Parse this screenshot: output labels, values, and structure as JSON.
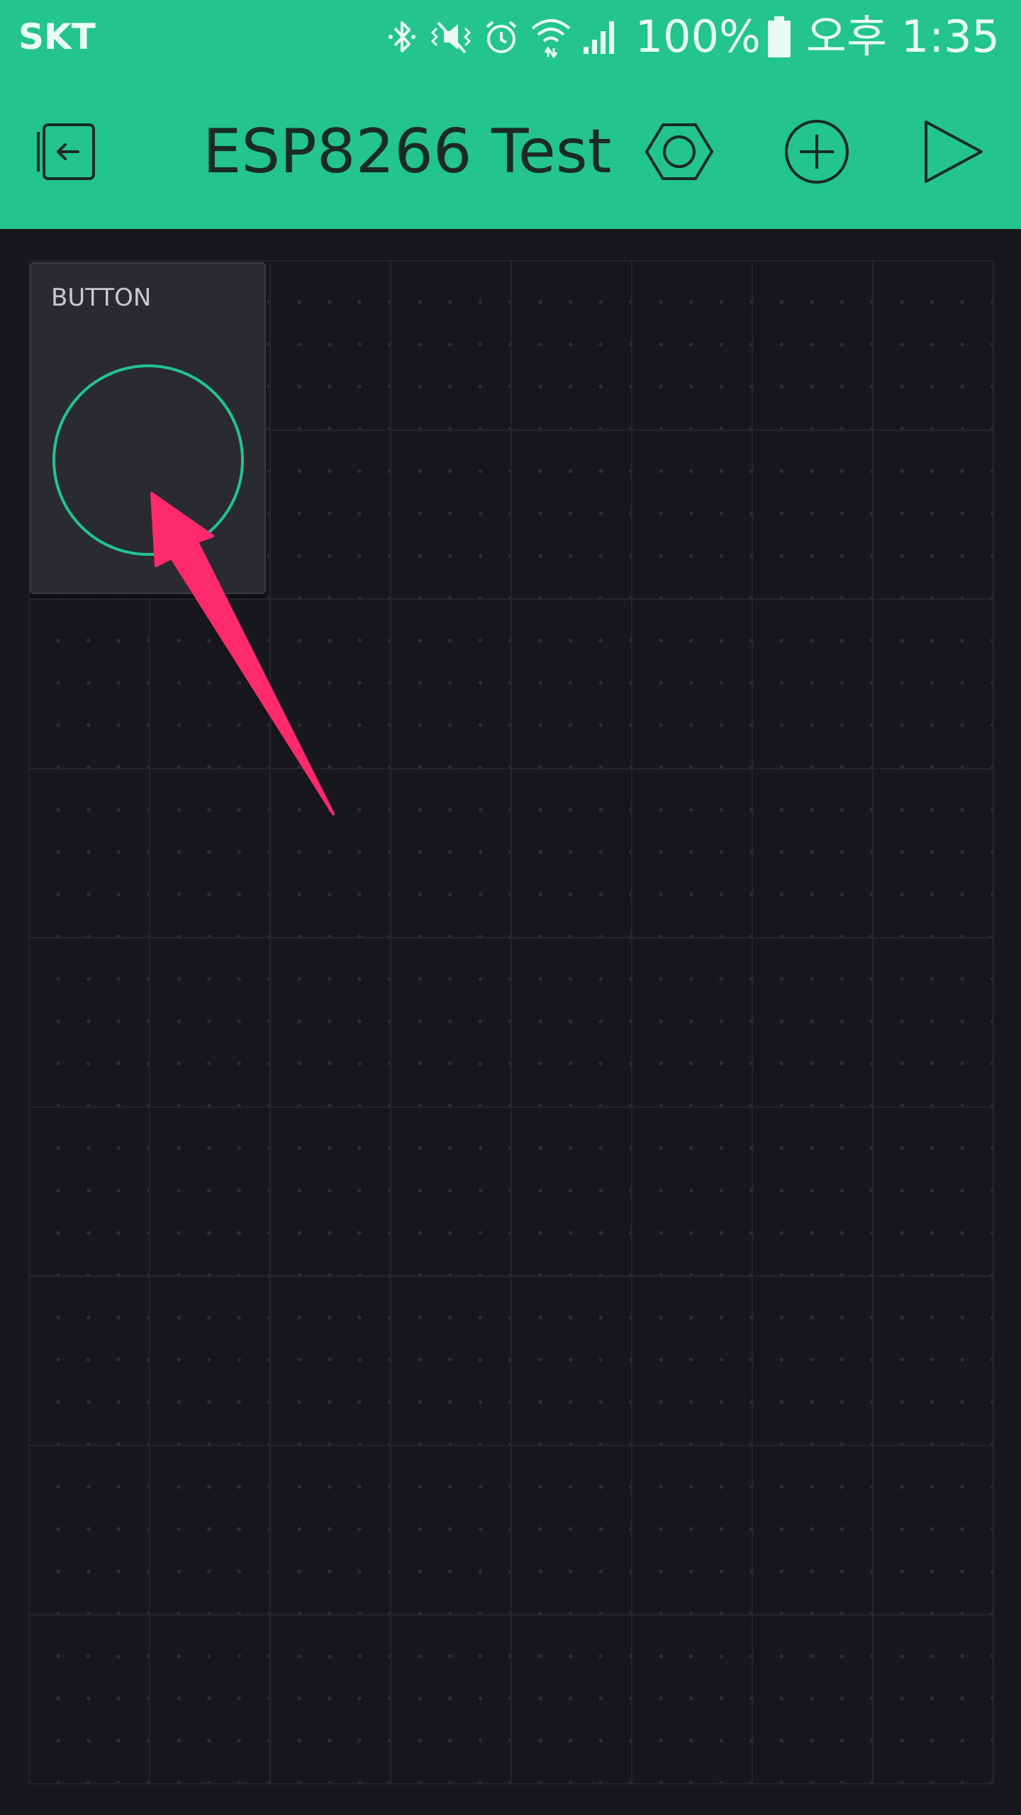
{
  "status_bar": {
    "carrier": "SKT",
    "battery": "100%",
    "time": "오후 1:35",
    "icons": [
      "bluetooth-icon",
      "vibrate-icon",
      "alarm-icon",
      "wifi-icon",
      "signal-icon",
      "battery-icon"
    ]
  },
  "app_bar": {
    "title": "ESP8266 Test",
    "icons": [
      "exit-icon",
      "settings-icon",
      "add-icon",
      "play-icon"
    ]
  },
  "widgets": [
    {
      "label": "BUTTON",
      "type": "button"
    }
  ],
  "colors": {
    "accent": "#23c48e",
    "background": "#16161c",
    "widget": "#2a2b30",
    "annotation": "#ff2a6d"
  }
}
